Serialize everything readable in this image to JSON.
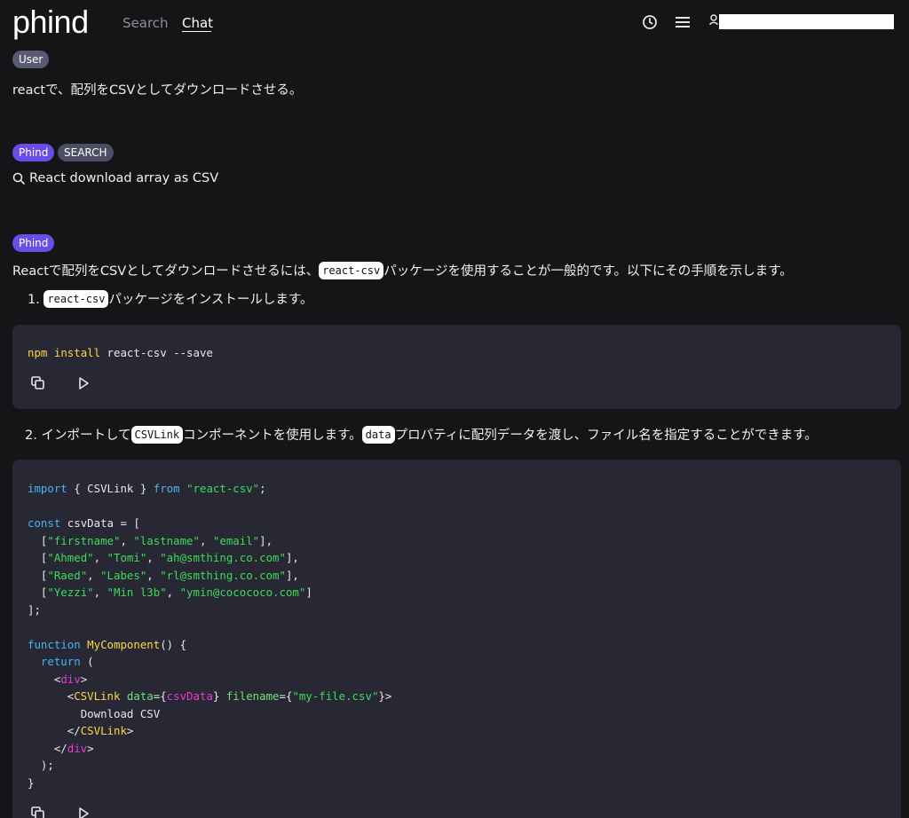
{
  "header": {
    "logo": "phind",
    "nav": {
      "search": "Search",
      "chat": "Chat"
    },
    "icons": [
      "history-icon",
      "menu-icon",
      "user-icon"
    ]
  },
  "messages": {
    "user": {
      "badge": "User",
      "text": "reactで、配列をCSVとしてダウンロードさせる。"
    },
    "search": {
      "badges": [
        "Phind",
        "SEARCH"
      ],
      "query": "React download array as CSV"
    },
    "answer": {
      "badge": "Phind",
      "intro_before": "Reactで配列をCSVとしてダウンロードさせるには、",
      "intro_code": "react-csv",
      "intro_after": "パッケージを使用することが一般的です。以下にその手順を示します。",
      "step1_num": "1.",
      "step1_code": "react-csv",
      "step1_text": "パッケージをインストールします。",
      "step2_num": "2.",
      "step2_before": "インポートして",
      "step2_code1": "CSVLink",
      "step2_mid": "コンポーネントを使用します。",
      "step2_code2": "data",
      "step2_after": "プロパティに配列データを渡し、ファイル名を指定することができます。"
    }
  },
  "code1": {
    "npm": "npm",
    "install": "install",
    "rest": " react-csv --save"
  },
  "code2": {
    "import_kw": "import",
    "import_braces": " { CSVLink } ",
    "from_kw": "from",
    "import_src": "\"react-csv\"",
    "semicolon": ";",
    "const_kw": "const",
    "const_rest": " csvData = [",
    "rows": [
      [
        "\"firstname\"",
        "\"lastname\"",
        "\"email\""
      ],
      [
        "\"Ahmed\"",
        "\"Tomi\"",
        "\"ah@smthing.co.com\""
      ],
      [
        "\"Raed\"",
        "\"Labes\"",
        "\"rl@smthing.co.com\""
      ],
      [
        "\"Yezzi\"",
        "\"Min l3b\"",
        "\"ymin@cocococo.com\""
      ]
    ],
    "array_close": "];",
    "function_kw": "function",
    "fn_name": "MyComponent",
    "fn_rest": "() {",
    "return_kw": "return",
    "return_rest": " (",
    "div_tag": "div",
    "csvlink_tag": "CSVLink",
    "data_attr": "data",
    "data_val": "csvData",
    "filename_attr": "filename",
    "filename_val": "\"my-file.csv\"",
    "download_text": "Download CSV",
    "paren_close": ");",
    "brace_close": "}"
  }
}
